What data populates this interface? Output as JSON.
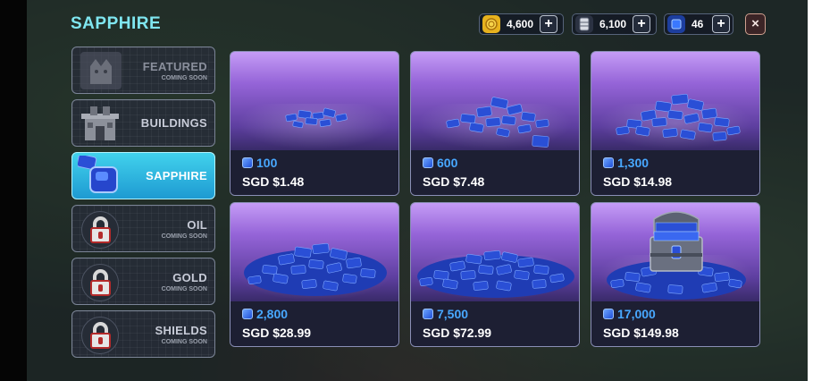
{
  "title": "SAPPHIRE",
  "currencies": [
    {
      "name": "gold-coin",
      "icon": "coin-icon",
      "value": "4,600"
    },
    {
      "name": "oil",
      "icon": "oil-drum-icon",
      "value": "6,100"
    },
    {
      "name": "sapphire",
      "icon": "sapphire-icon",
      "value": "46"
    }
  ],
  "plus_label": "+",
  "close_label": "×",
  "tabs": [
    {
      "label": "FEATURED",
      "sub": "COMING SOON",
      "icon": "featured-icon",
      "active": false
    },
    {
      "label": "BUILDINGS",
      "sub": "",
      "icon": "building-icon",
      "active": false
    },
    {
      "label": "SAPPHIRE",
      "sub": "",
      "icon": "sapphire-icon",
      "active": true
    },
    {
      "label": "OIL",
      "sub": "COMING SOON",
      "icon": "lock-icon",
      "active": false
    },
    {
      "label": "GOLD",
      "sub": "COMING SOON",
      "icon": "lock-icon",
      "active": false
    },
    {
      "label": "SHIELDS",
      "sub": "COMING SOON",
      "icon": "lock-icon",
      "active": false
    }
  ],
  "offers": [
    {
      "amount": "100",
      "price": "SGD $1.48"
    },
    {
      "amount": "600",
      "price": "SGD $7.48"
    },
    {
      "amount": "1,300",
      "price": "SGD $14.98"
    },
    {
      "amount": "2,800",
      "price": "SGD $28.99"
    },
    {
      "amount": "7,500",
      "price": "SGD $72.99"
    },
    {
      "amount": "17,000",
      "price": "SGD $149.98"
    }
  ],
  "colors": {
    "title": "#7fe6f0",
    "active_tab": "#2fb8e2",
    "amount": "#48a8ff",
    "card_glow": "#9564d8",
    "gem": "#2a4fd6"
  }
}
